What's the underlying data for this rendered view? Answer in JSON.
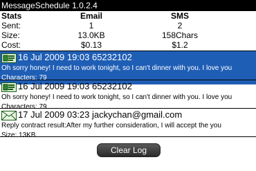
{
  "app": {
    "title": "MessageSchedule 1.0.2.4"
  },
  "stats": {
    "header": {
      "label": "Stats",
      "col1": "Email",
      "col2": "SMS"
    },
    "rows": [
      {
        "label": "Sent:",
        "email": "1",
        "sms": "2"
      },
      {
        "label": "Size:",
        "email": "13.0KB",
        "sms": "158Chars"
      },
      {
        "label": "Cost:",
        "email": "$0.13",
        "sms": "$1.2"
      }
    ]
  },
  "messages": [
    {
      "type": "sms",
      "icon": "sms-icon",
      "selected": true,
      "header": "16 Jul 2009 19:03 65232102",
      "preview": "Oh sorry honey! I need to work tonight, so I can't dinner with you. I love you",
      "meta": "Characters: 79"
    },
    {
      "type": "sms",
      "icon": "sms-icon",
      "selected": false,
      "header": "16 Jul 2009 19:03 65232102",
      "preview": "Oh sorry honey! I need to work tonight, so I can't dinner with you. I love you",
      "meta": "Characters: 79"
    },
    {
      "type": "email",
      "icon": "email-envelope-icon",
      "selected": false,
      "header": "17 Jul 2009 03:23 jackychan@gmail.com",
      "preview": "Reply contract result:After my further consideration, I will accept the you",
      "meta": "Size: 13KB"
    }
  ],
  "footer": {
    "clear_label": "Clear Log"
  },
  "colors": {
    "selection": "#1f5eb5",
    "titlebar": "#000000"
  }
}
